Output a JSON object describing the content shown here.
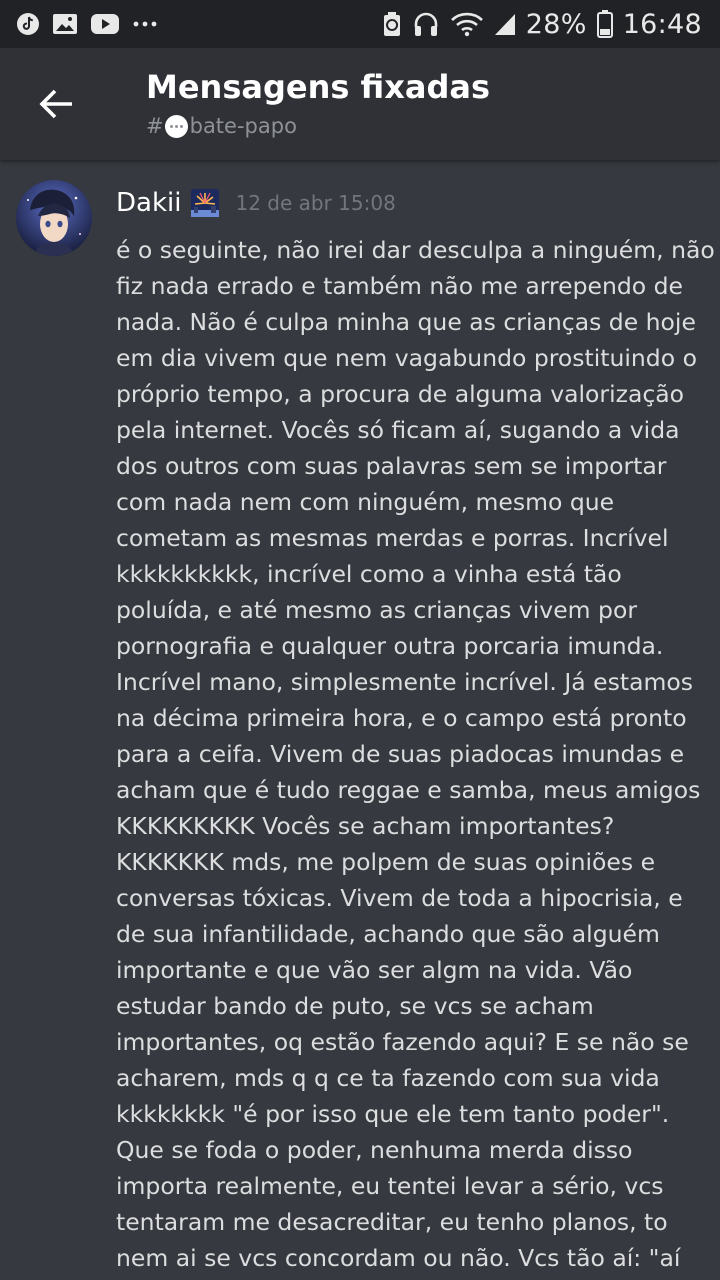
{
  "status_bar": {
    "battery": "28%",
    "time": "16:48",
    "left_icons": [
      "tiktok-icon",
      "gallery-icon",
      "youtube-icon",
      "more-dots-icon"
    ],
    "right_icons": [
      "save-mode-icon",
      "headphones-icon",
      "wifi-icon",
      "signal-icon",
      "battery-icon"
    ]
  },
  "header": {
    "title": "Mensagens fixadas",
    "channel_prefix": "#",
    "channel_name": "bate-papo"
  },
  "message": {
    "author": "Dakii",
    "timestamp": "12 de abr 15:08",
    "lines": [
      "é o seguinte, não irei dar desculpa a ninguém, não",
      "fiz nada errado e também não me arrependo de",
      "nada. Não é culpa minha que as crianças de hoje",
      "em dia vivem que nem vagabundo prostituindo o",
      "próprio tempo, a procura de alguma valorização",
      "pela internet. Vocês só ficam aí, sugando a vida",
      "dos outros com suas palavras sem se importar",
      "com nada nem com ninguém, mesmo que",
      "cometam as mesmas merdas e porras. Incrível",
      "kkkkkkkkkk, incrível como a vinha está tão",
      "poluída, e até mesmo as crianças vivem por",
      "pornografia e qualquer outra porcaria imunda.",
      "Incrível mano, simplesmente incrível. Já estamos",
      "na décima primeira hora, e o campo está pronto",
      "para a ceifa. Vivem de suas piadocas imundas e",
      "acham que é tudo reggae e samba, meus amigos",
      "KKKKKKKKK Vocês se acham importantes?",
      "KKKKKKK mds, me polpem de suas opiniões e",
      "conversas tóxicas. Vivem de toda a hipocrisia, e",
      "de sua infantilidade, achando que são alguém",
      "importante e que vão ser algm na vida. Vão",
      "estudar bando de puto, se vcs se acham",
      "importantes, oq estão fazendo aqui? E se não se",
      "acharem, mds q q ce ta fazendo com sua vida",
      "kkkkkkkk \"é por isso que ele tem tanto poder\".",
      "Que se foda o poder, nenhuma merda disso",
      "importa realmente, eu tentei levar a sério, vcs",
      "tentaram me desacreditar, eu tenho planos, to",
      "nem ai se vcs concordam ou não. Vcs tão aí: \"aí"
    ]
  }
}
